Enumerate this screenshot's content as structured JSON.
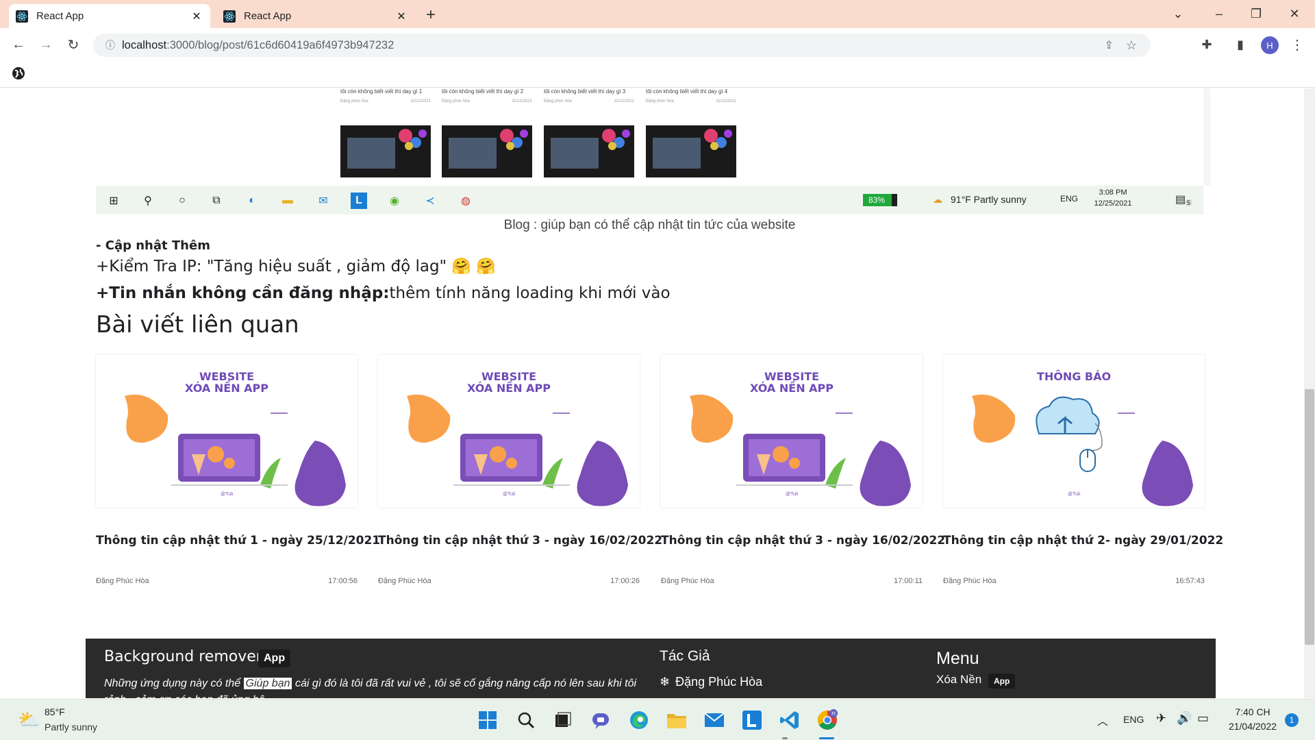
{
  "browser": {
    "tabs": [
      {
        "title": "React App"
      },
      {
        "title": "React App"
      }
    ],
    "address": {
      "host": "localhost",
      "path": ":3000/blog/post/61c6d60419a6f4973b947232"
    },
    "profile_initial": "H"
  },
  "screenshot": {
    "posts": [
      {
        "title": "tôi còn không biết viết thì day gì 1",
        "author": "Đặng phúc hòa",
        "date": "11/12/2021"
      },
      {
        "title": "tôi còn không biết viết thì day gì 2",
        "author": "Đặng phúc hòa",
        "date": "11/12/2021"
      },
      {
        "title": "tôi còn không biết viết thì day gì 3",
        "author": "Đặng phúc hòa",
        "date": "11/12/2021"
      },
      {
        "title": "tôi còn không biết viết thì day gì 4",
        "author": "Đặng phúc hòa",
        "date": "11/12/2021"
      }
    ],
    "taskbar": {
      "battery": "83%",
      "weather": "91°F  Partly sunny",
      "lang": "ENG",
      "time": "3:08 PM",
      "date": "12/25/2021",
      "notif": "5"
    }
  },
  "article": {
    "caption": "Blog : giúp bạn có thể cập nhật tin tức của website",
    "update_heading": "- Cập nhật Thêm",
    "line2": "+Kiểm Tra IP: \"Tăng hiệu suất , giảm độ lag\" 🤗 🤗",
    "line3_bold": "+Tin nhắn không cần đăng nhập:",
    "line3_rest": "thêm tính năng loading khi mới vào"
  },
  "related": {
    "heading": "Bài viết liên quan",
    "cards": [
      {
        "thumb_title": "WEBSITE\nXÓA NỀN APP",
        "title": "Thông tin cập nhật thứ 1 - ngày 25/12/2021",
        "author": "Đặng Phúc Hòa",
        "time": "17:00:56"
      },
      {
        "thumb_title": "WEBSITE\nXÓA NỀN APP",
        "title": "Thông tin cập nhật thứ 3 - ngày 16/02/2022",
        "author": "Đặng Phúc Hòa",
        "time": "17:00:26"
      },
      {
        "thumb_title": "WEBSITE\nXÓA NỀN APP",
        "title": "Thông tin cập nhật thứ 3 - ngày 16/02/2022",
        "author": "Đặng Phúc Hòa",
        "time": "17:00:11"
      },
      {
        "thumb_title": "THÔNG BÁO",
        "title": "Thông tin cập nhật thứ 2- ngày 29/01/2022",
        "author": "Đặng Phúc Hòa",
        "time": "16:57:43"
      }
    ],
    "thumb_watermark": "@Tuli"
  },
  "footer": {
    "title": "Background remover",
    "badge": "App",
    "desc_before": "Những ứng dụng này có thể",
    "desc_highlight": "Giúp bạn",
    "desc_after": "cái gì đó là tôi đã rất vui vẻ , tôi sẽ cố gắng nâng cấp nó lên sau khi tôi rảnh , cảm ơn các bạn đã ủng hộ",
    "author_heading": "Tác Giả",
    "author_name": "Đặng Phúc Hòa",
    "menu_heading": "Menu",
    "menu_item": "Xóa Nền",
    "menu_badge": "App"
  },
  "taskbar": {
    "weather_temp": "85°F",
    "weather_desc": "Partly sunny",
    "lang": "ENG",
    "time": "7:40 CH",
    "date": "21/04/2022",
    "notif": "1"
  },
  "colors": {
    "tabbar": "#f9dccd",
    "accent_purple": "#7b4db6",
    "orange_blob": "#f9a14a",
    "footer": "#2b2b2b"
  }
}
